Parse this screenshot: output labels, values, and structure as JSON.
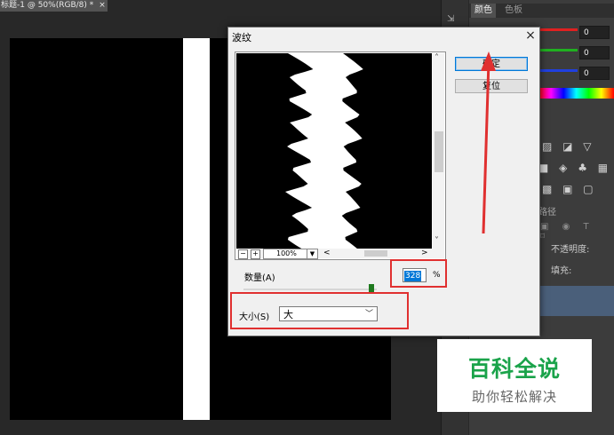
{
  "document_tab": {
    "title": "标题-1 @ 50%(RGB/8) *",
    "close": "×"
  },
  "right_panel": {
    "tabs": [
      "颜色",
      "色板"
    ],
    "color_values": [
      "0",
      "0",
      "0"
    ],
    "slider_colors": [
      "#e02020",
      "#20b020",
      "#2040e0"
    ],
    "adjustment_rows": [
      "▨ ◪ ▽",
      "■ ◈ ♣ ▦",
      "▩ ▣ ▢"
    ],
    "paths_tab": "路径",
    "layer_icons": "▣ ◉ T ⌑",
    "opacity_label": "不透明度:",
    "fill_label": "填充:"
  },
  "dialog": {
    "title": "波纹",
    "close": "×",
    "ok_label": "确定",
    "reset_label": "复位",
    "zoom": {
      "value": "100%",
      "minus": "−",
      "plus": "+"
    },
    "amount": {
      "label": "数量(A)",
      "value": "328",
      "unit": "%",
      "slider_fraction": 0.96
    },
    "size": {
      "label": "大小(S)",
      "value": "大"
    }
  },
  "watermark": {
    "title": "百科全说",
    "subtitle": "助你轻松解决"
  },
  "colors": {
    "canvas": "#000000",
    "highlight": "#e03030",
    "accent": "#0078d7",
    "watermark_green": "#1aa34a"
  }
}
